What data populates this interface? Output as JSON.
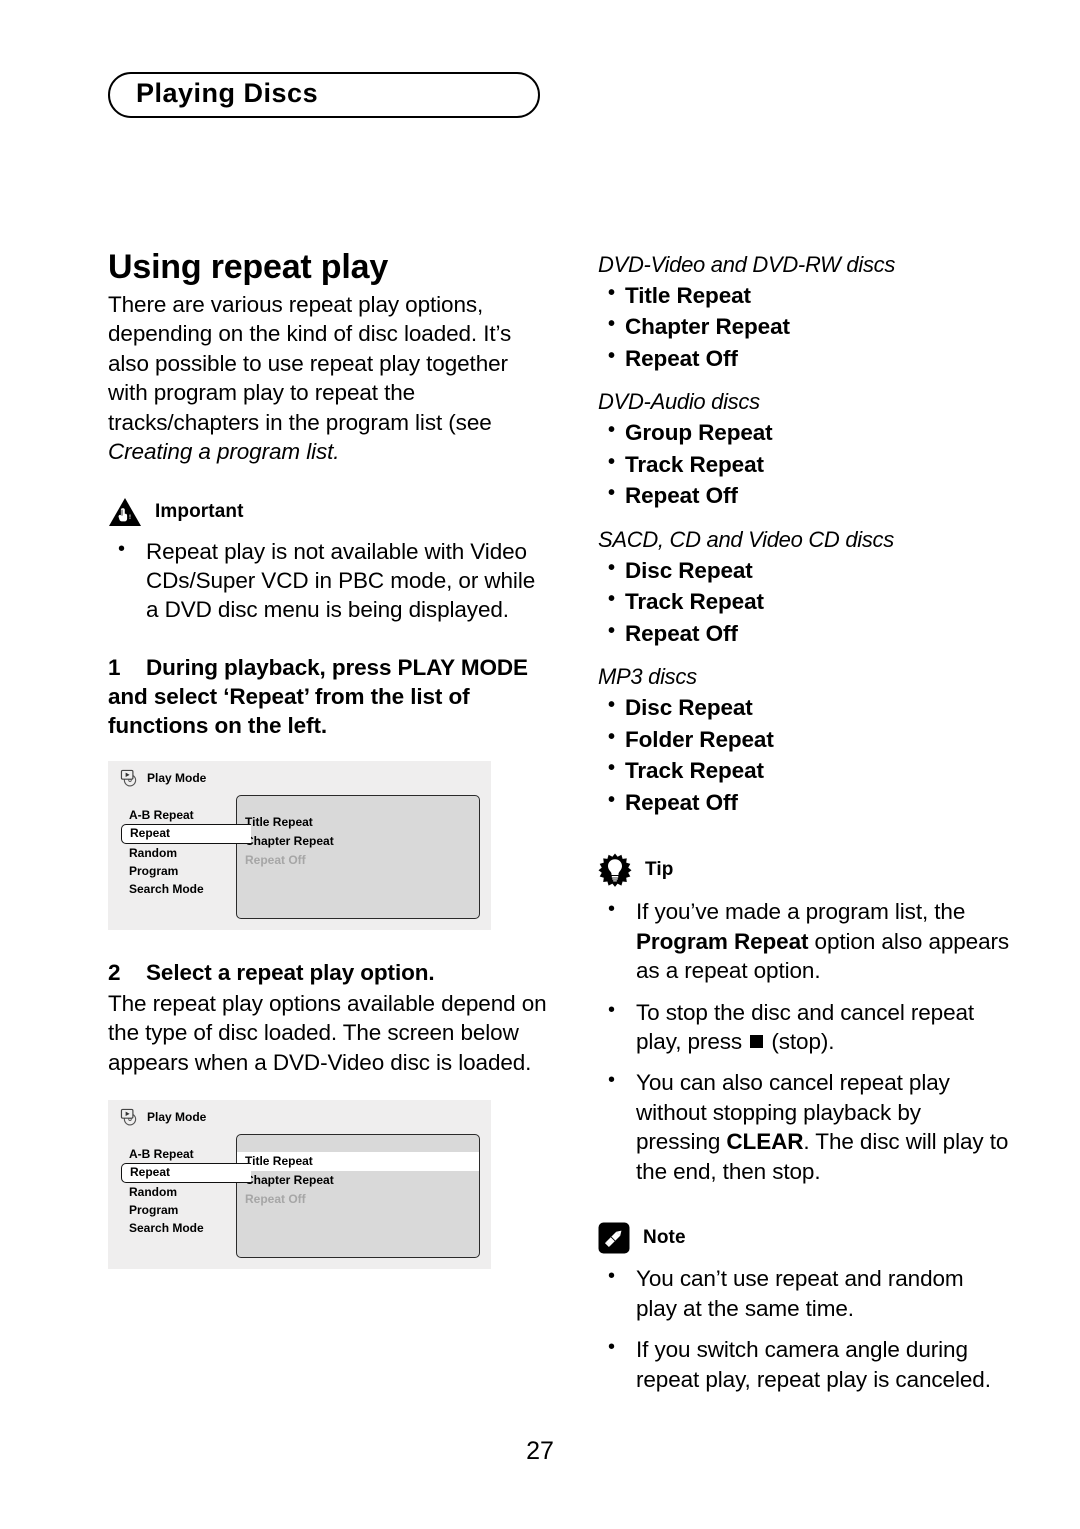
{
  "header": {
    "title": "Playing Discs"
  },
  "page": {
    "number": "27"
  },
  "left": {
    "section_title": "Using repeat play",
    "intro_plain_1": "There are various repeat play options, depending on the kind of disc loaded. It’s also possible to use repeat play together with program play to repeat the tracks/chapters in the program list (see ",
    "intro_italic": "Creating a program list.",
    "important": {
      "icon": "warning-triangle-hand-icon",
      "label": "Important",
      "bullets": [
        "Repeat play is not available with Video CDs/Super VCD in PBC mode, or while a DVD disc menu is being displayed."
      ]
    },
    "step1": {
      "number": "1",
      "text": "During playback, press PLAY MODE and select ‘Repeat’ from the list of functions on the left."
    },
    "step2": {
      "number": "2",
      "text": "Select a repeat play option.",
      "body": "The repeat play options available depend on the type of disc loaded. The screen below appears when a DVD-Video disc is loaded."
    },
    "osd1": {
      "icon": "play-mode-disc-icon",
      "title": "Play Mode",
      "menu": [
        {
          "label": "A-B Repeat",
          "selected": false
        },
        {
          "label": "Repeat",
          "selected": true
        },
        {
          "label": "Random",
          "selected": false
        },
        {
          "label": "Program",
          "selected": false
        },
        {
          "label": "Search Mode",
          "selected": false
        }
      ],
      "options": [
        {
          "label": "Title Repeat",
          "state": "normal"
        },
        {
          "label": "Chapter Repeat",
          "state": "normal"
        },
        {
          "label": "Repeat Off",
          "state": "dim"
        }
      ]
    },
    "osd2": {
      "icon": "play-mode-disc-icon",
      "title": "Play Mode",
      "menu": [
        {
          "label": "A-B Repeat",
          "selected": false
        },
        {
          "label": "Repeat",
          "selected": true
        },
        {
          "label": "Random",
          "selected": false
        },
        {
          "label": "Program",
          "selected": false
        },
        {
          "label": "Search Mode",
          "selected": false
        }
      ],
      "options": [
        {
          "label": "Title Repeat",
          "state": "highlighted"
        },
        {
          "label": "Chapter Repeat",
          "state": "normal"
        },
        {
          "label": "Repeat Off",
          "state": "dim"
        }
      ]
    }
  },
  "right": {
    "groups": [
      {
        "heading": "DVD-Video and DVD-RW discs",
        "items": [
          "Title Repeat",
          "Chapter Repeat",
          "Repeat Off"
        ]
      },
      {
        "heading": "DVD-Audio discs",
        "items": [
          "Group Repeat",
          "Track Repeat",
          "Repeat Off"
        ]
      },
      {
        "heading": "SACD, CD and Video CD discs",
        "items": [
          "Disc Repeat",
          "Track Repeat",
          "Repeat Off"
        ]
      },
      {
        "heading": "MP3 discs",
        "items": [
          "Disc Repeat",
          "Folder Repeat",
          "Track Repeat",
          "Repeat Off"
        ]
      }
    ],
    "tip": {
      "icon": "lightbulb-starburst-icon",
      "label": "Tip",
      "bullets": [
        {
          "pre": "If you’ve made a program list, the ",
          "bold": "Program Repeat",
          "post": " option also appears as a repeat option."
        },
        {
          "pre": "To stop the disc and cancel repeat play, press ",
          "symbol": "stop-square-icon",
          "post": " (stop)."
        },
        {
          "pre": "You can also cancel repeat play without stopping playback by pressing ",
          "bold": "CLEAR",
          "post": ". The disc will play to the end, then stop."
        }
      ]
    },
    "note": {
      "icon": "pencil-note-icon",
      "label": "Note",
      "bullets": [
        "You can’t use repeat and random play at the same time.",
        "If you switch camera angle during repeat play, repeat play is canceled."
      ]
    }
  },
  "colors": {
    "ink": "#000000",
    "paper": "#ffffff",
    "osd_background": "#efeeee",
    "osd_panel": "#d9d9d9",
    "osd_dim_text": "#a6a6a6"
  }
}
